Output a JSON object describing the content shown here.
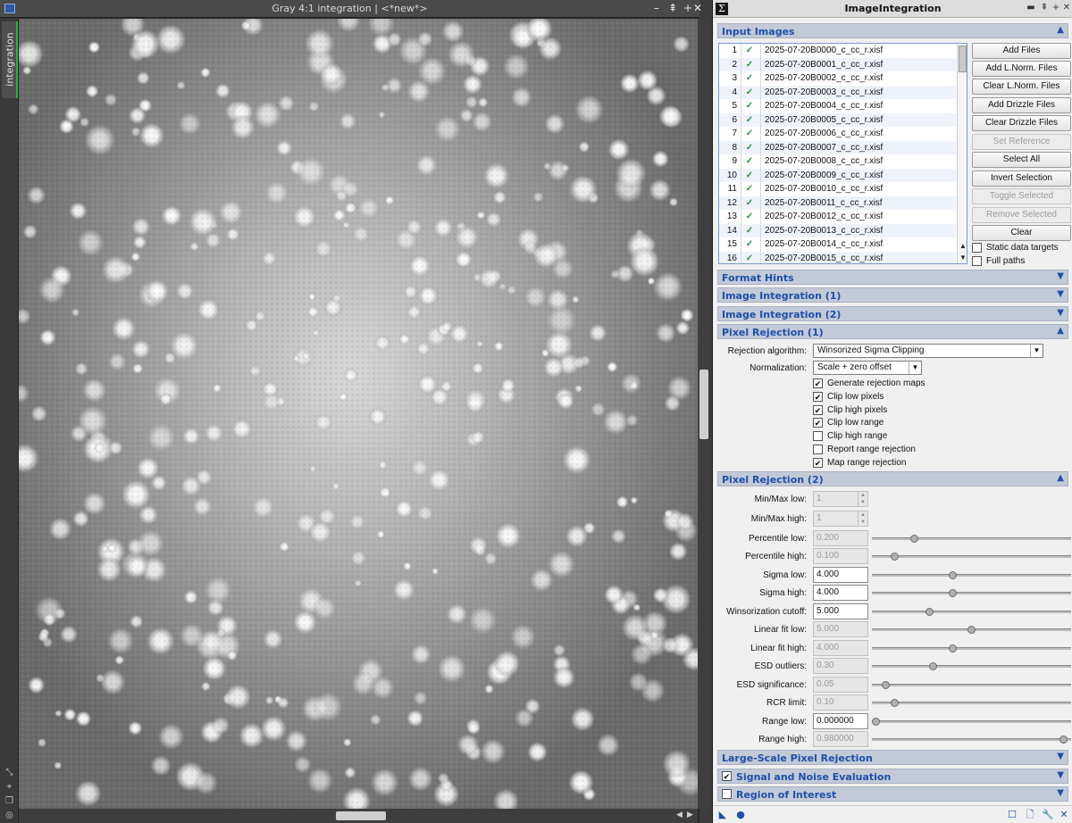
{
  "image_window": {
    "title": "Gray 4:1 integration | <*new*>",
    "side_tab": "integration",
    "buttons": {
      "minimize": "–",
      "maximize": "⇞",
      "add": "+",
      "close": "✕"
    }
  },
  "panel": {
    "title": "ImageIntegration",
    "title_icon": "Σ",
    "titlebar_buttons": {
      "minimize": "▬",
      "shade": "⇞",
      "add": "+",
      "close": "✕"
    },
    "sections": {
      "input_images": "Input Images",
      "format_hints": "Format Hints",
      "image_integration_1": "Image Integration (1)",
      "image_integration_2": "Image Integration (2)",
      "pixel_rejection_1": "Pixel Rejection (1)",
      "pixel_rejection_2": "Pixel Rejection (2)",
      "large_scale": "Large-Scale Pixel Rejection",
      "signal_noise": "Signal and Noise Evaluation",
      "region_of_interest": "Region of Interest"
    },
    "files": [
      {
        "idx": "1",
        "name": "2025-07-20B0000_c_cc_r.xisf"
      },
      {
        "idx": "2",
        "name": "2025-07-20B0001_c_cc_r.xisf"
      },
      {
        "idx": "3",
        "name": "2025-07-20B0002_c_cc_r.xisf"
      },
      {
        "idx": "4",
        "name": "2025-07-20B0003_c_cc_r.xisf"
      },
      {
        "idx": "5",
        "name": "2025-07-20B0004_c_cc_r.xisf"
      },
      {
        "idx": "6",
        "name": "2025-07-20B0005_c_cc_r.xisf"
      },
      {
        "idx": "7",
        "name": "2025-07-20B0006_c_cc_r.xisf"
      },
      {
        "idx": "8",
        "name": "2025-07-20B0007_c_cc_r.xisf"
      },
      {
        "idx": "9",
        "name": "2025-07-20B0008_c_cc_r.xisf"
      },
      {
        "idx": "10",
        "name": "2025-07-20B0009_c_cc_r.xisf"
      },
      {
        "idx": "11",
        "name": "2025-07-20B0010_c_cc_r.xisf"
      },
      {
        "idx": "12",
        "name": "2025-07-20B0011_c_cc_r.xisf"
      },
      {
        "idx": "13",
        "name": "2025-07-20B0012_c_cc_r.xisf"
      },
      {
        "idx": "14",
        "name": "2025-07-20B0013_c_cc_r.xisf"
      },
      {
        "idx": "15",
        "name": "2025-07-20B0014_c_cc_r.xisf"
      },
      {
        "idx": "16",
        "name": "2025-07-20B0015_c_cc_r.xisf"
      }
    ],
    "buttons": {
      "add_files": "Add Files",
      "add_lnorm": "Add L.Norm. Files",
      "clear_lnorm": "Clear L.Norm. Files",
      "add_drizzle": "Add Drizzle Files",
      "clear_drizzle": "Clear Drizzle Files",
      "set_reference": "Set Reference",
      "select_all": "Select All",
      "invert_selection": "Invert Selection",
      "toggle_selected": "Toggle Selected",
      "remove_selected": "Remove Selected",
      "clear": "Clear"
    },
    "checkboxes": {
      "static_targets": "Static data targets",
      "full_paths": "Full paths"
    },
    "pixel_rejection_1": {
      "algorithm_label": "Rejection algorithm:",
      "algorithm_value": "Winsorized Sigma Clipping",
      "normalization_label": "Normalization:",
      "normalization_value": "Scale + zero offset",
      "options": [
        {
          "label": "Generate rejection maps",
          "checked": "✔"
        },
        {
          "label": "Clip low pixels",
          "checked": "✔"
        },
        {
          "label": "Clip high pixels",
          "checked": "✔"
        },
        {
          "label": "Clip low range",
          "checked": "✔"
        },
        {
          "label": "Clip high range",
          "checked": ""
        },
        {
          "label": "Report range rejection",
          "checked": ""
        },
        {
          "label": "Map range rejection",
          "checked": "✔"
        }
      ]
    },
    "pixel_rejection_2": {
      "minmax_low_label": "Min/Max low:",
      "minmax_low": "1",
      "minmax_high_label": "Min/Max high:",
      "minmax_high": "1",
      "rows": [
        {
          "label": "Percentile low:",
          "value": "0.200",
          "slider": 0.2
        },
        {
          "label": "Percentile high:",
          "value": "0.100",
          "slider": 0.1
        },
        {
          "label": "Sigma low:",
          "value": "4.000",
          "slider": 0.4
        },
        {
          "label": "Sigma high:",
          "value": "4.000",
          "slider": 0.4
        },
        {
          "label": "Winsorization cutoff:",
          "value": "5.000",
          "slider": 0.28
        },
        {
          "label": "Linear fit low:",
          "value": "5.000",
          "slider": 0.5
        },
        {
          "label": "Linear fit high:",
          "value": "4.000",
          "slider": 0.4
        },
        {
          "label": "ESD outliers:",
          "value": "0.30",
          "slider": 0.3
        },
        {
          "label": "ESD significance:",
          "value": "0.05",
          "slider": 0.05
        },
        {
          "label": "RCR limit:",
          "value": "0.10",
          "slider": 0.1
        },
        {
          "label": "Range low:",
          "value": "0.000000",
          "slider": 0.0
        },
        {
          "label": "Range high:",
          "value": "0.980000",
          "slider": 0.98
        }
      ]
    },
    "bottom_icons": [
      "new-instance-icon",
      "apply-global-icon",
      "preview-icon",
      "document-icon",
      "wrench-icon",
      "reset-icon"
    ]
  },
  "colors": {
    "section_header_bg": "#c2cad7",
    "section_header_text": "#1f4fa8",
    "check_green": "#1a9a35",
    "tab_accent": "#27b34a"
  }
}
